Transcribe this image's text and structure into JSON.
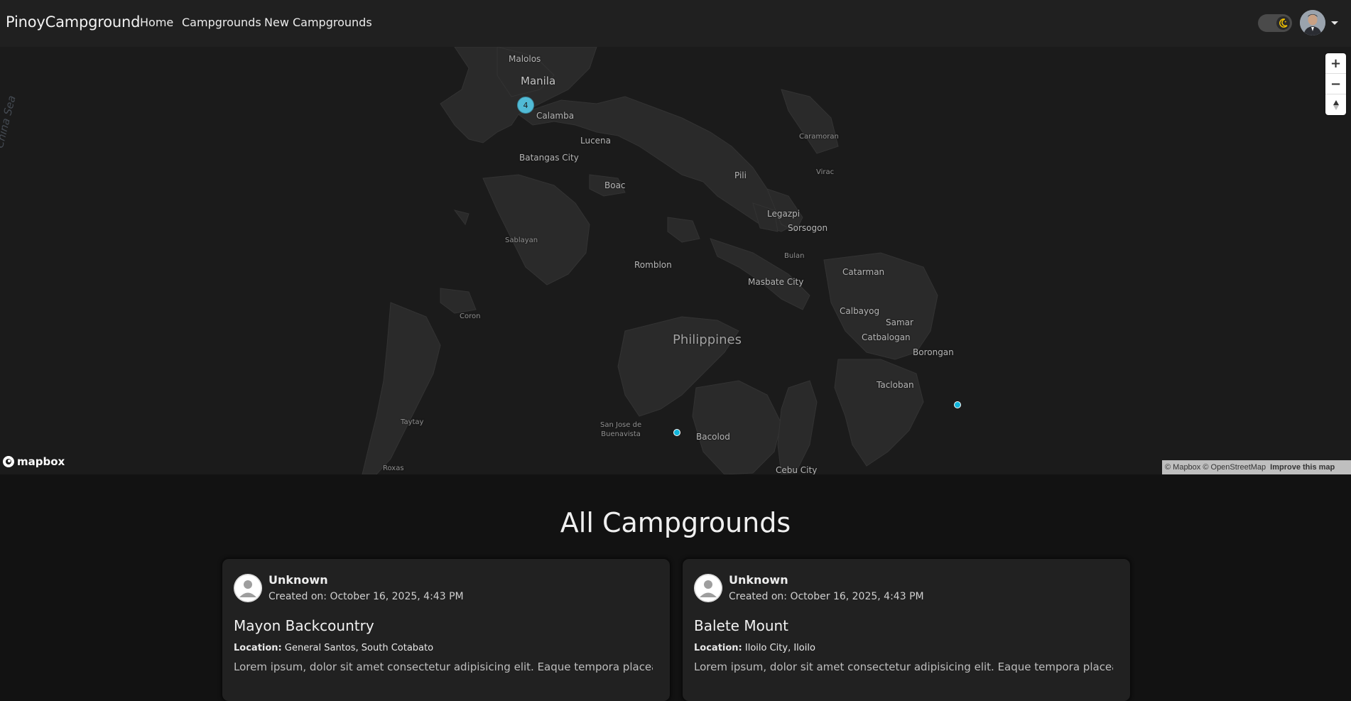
{
  "navbar": {
    "brand": "PinoyCampground",
    "links": [
      "Home",
      "Campgrounds",
      "New Campgrounds"
    ],
    "theme_toggle_icon": "moon-icon",
    "accent_color": "#f2c200"
  },
  "map": {
    "sea_label": "China Sea",
    "places": {
      "malolos": "Malolos",
      "manila": "Manila",
      "calamba": "Calamba",
      "lucena": "Lucena",
      "batangas": "Batangas City",
      "boac": "Boac",
      "caramoran": "Caramoran",
      "virac": "Virac",
      "pili": "Pili",
      "legazpi": "Legazpi",
      "sorsogon": "Sorsogon",
      "bulan": "Bulan",
      "sablayan": "Sablayan",
      "romblon": "Romblon",
      "masbate": "Masbate City",
      "catarman": "Catarman",
      "calbayog": "Calbayog",
      "samar": "Samar",
      "catbalogan": "Catbalogan",
      "borongan": "Borongan",
      "coron": "Coron",
      "philippines": "Philippines",
      "tacloban": "Tacloban",
      "taytay": "Taytay",
      "sanjose": "San Jose de\nBuenavista",
      "bacolod": "Bacolod",
      "roxas": "Roxas",
      "cebu": "Cebu City"
    },
    "cluster_count": "4",
    "cluster_color": "#51bbd6",
    "pin_color": "#11b4da",
    "zoom_in": "+",
    "zoom_out": "−",
    "compass": "compass-icon",
    "logo_text": "mapbox",
    "attribution": "© Mapbox © OpenStreetMap",
    "improve": "Improve this map"
  },
  "main": {
    "title": "All Campgrounds",
    "cards": [
      {
        "author": "Unknown",
        "created": "Created on: October 16, 2025, 4:43 PM",
        "name": "Mayon Backcountry",
        "location_label": "Location:",
        "location": "General Santos, South Cotabato",
        "description": "Lorem ipsum, dolor sit amet consectetur adipisicing elit. Eaque tempora placeat"
      },
      {
        "author": "Unknown",
        "created": "Created on: October 16, 2025, 4:43 PM",
        "name": "Balete Mount",
        "location_label": "Location:",
        "location": "Iloilo City, Iloilo",
        "description": "Lorem ipsum, dolor sit amet consectetur adipisicing elit. Eaque tempora placeat"
      }
    ]
  }
}
